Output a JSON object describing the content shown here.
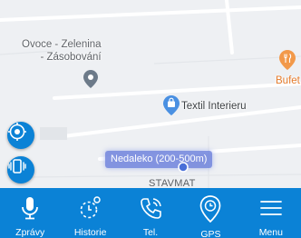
{
  "map": {
    "pois": [
      {
        "label": "Ovoce - Zelenina\n - Zásobování",
        "icon": "location-pin-icon",
        "color": "#6c7a89"
      },
      {
        "label": "Textil Interieru",
        "icon": "shopping-bag-pin-icon",
        "color": "#4a90e2"
      },
      {
        "label": "Bufet",
        "icon": "restaurant-pin-icon",
        "color": "#f2994a"
      }
    ],
    "nearby_label": "Nedaleko (200-500m)",
    "building_label": "STAVMAT"
  },
  "map_controls": {
    "locate_icon": "target-icon",
    "vibrate_icon": "vibrate-phone-icon",
    "color": "#0b82d6"
  },
  "bottom_nav": {
    "background": "#0b82d6",
    "items": [
      {
        "label": "Zprávy",
        "icon": "microphone-icon"
      },
      {
        "label": "Historie",
        "icon": "history-clock-icon"
      },
      {
        "label": "Tel.",
        "icon": "phone-call-icon"
      },
      {
        "label": "GPS",
        "icon": "gps-clock-pin-icon"
      },
      {
        "label": "Menu",
        "icon": "hamburger-menu-icon"
      }
    ]
  }
}
